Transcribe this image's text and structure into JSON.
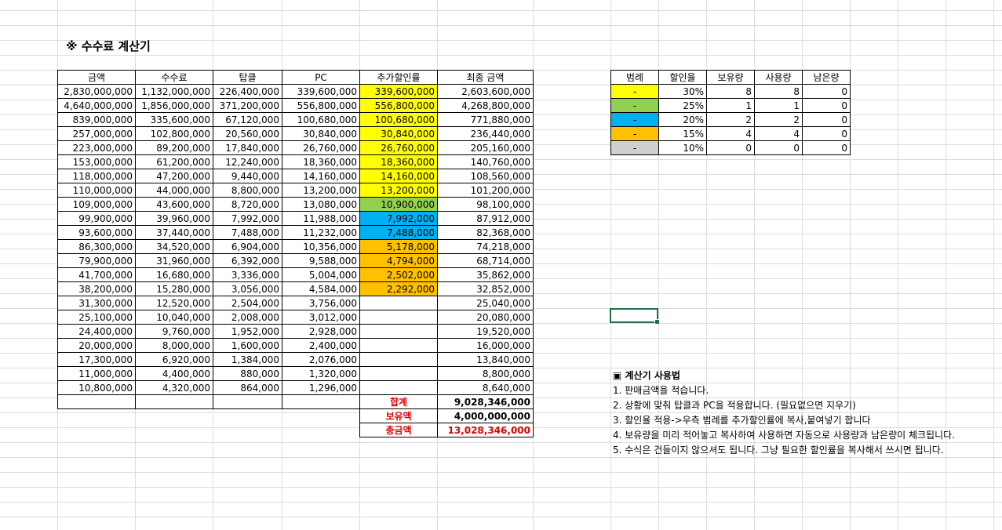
{
  "title": "※ 수수료 계산기",
  "main_table": {
    "headers": [
      "금액",
      "수수료",
      "탑클",
      "PC",
      "추가할인률",
      "최종 금액"
    ],
    "rows": [
      [
        "2,830,000,000",
        "1,132,000,000",
        "226,400,000",
        "339,600,000",
        "339,600,000",
        "2,603,600,000"
      ],
      [
        "4,640,000,000",
        "1,856,000,000",
        "371,200,000",
        "556,800,000",
        "556,800,000",
        "4,268,800,000"
      ],
      [
        "839,000,000",
        "335,600,000",
        "67,120,000",
        "100,680,000",
        "100,680,000",
        "771,880,000"
      ],
      [
        "257,000,000",
        "102,800,000",
        "20,560,000",
        "30,840,000",
        "30,840,000",
        "236,440,000"
      ],
      [
        "223,000,000",
        "89,200,000",
        "17,840,000",
        "26,760,000",
        "26,760,000",
        "205,160,000"
      ],
      [
        "153,000,000",
        "61,200,000",
        "12,240,000",
        "18,360,000",
        "18,360,000",
        "140,760,000"
      ],
      [
        "118,000,000",
        "47,200,000",
        "9,440,000",
        "14,160,000",
        "14,160,000",
        "108,560,000"
      ],
      [
        "110,000,000",
        "44,000,000",
        "8,800,000",
        "13,200,000",
        "13,200,000",
        "101,200,000"
      ],
      [
        "109,000,000",
        "43,600,000",
        "8,720,000",
        "13,080,000",
        "10,900,000",
        "98,100,000"
      ],
      [
        "99,900,000",
        "39,960,000",
        "7,992,000",
        "11,988,000",
        "7,992,000",
        "87,912,000"
      ],
      [
        "93,600,000",
        "37,440,000",
        "7,488,000",
        "11,232,000",
        "7,488,000",
        "82,368,000"
      ],
      [
        "86,300,000",
        "34,520,000",
        "6,904,000",
        "10,356,000",
        "5,178,000",
        "74,218,000"
      ],
      [
        "79,900,000",
        "31,960,000",
        "6,392,000",
        "9,588,000",
        "4,794,000",
        "68,714,000"
      ],
      [
        "41,700,000",
        "16,680,000",
        "3,336,000",
        "5,004,000",
        "2,502,000",
        "35,862,000"
      ],
      [
        "38,200,000",
        "15,280,000",
        "3,056,000",
        "4,584,000",
        "2,292,000",
        "32,852,000"
      ],
      [
        "31,300,000",
        "12,520,000",
        "2,504,000",
        "3,756,000",
        "",
        "25,040,000"
      ],
      [
        "25,100,000",
        "10,040,000",
        "2,008,000",
        "3,012,000",
        "",
        "20,080,000"
      ],
      [
        "24,400,000",
        "9,760,000",
        "1,952,000",
        "2,928,000",
        "",
        "19,520,000"
      ],
      [
        "20,000,000",
        "8,000,000",
        "1,600,000",
        "2,400,000",
        "",
        "16,000,000"
      ],
      [
        "17,300,000",
        "6,920,000",
        "1,384,000",
        "2,076,000",
        "",
        "13,840,000"
      ],
      [
        "11,000,000",
        "4,400,000",
        "880,000",
        "1,320,000",
        "",
        "8,800,000"
      ],
      [
        "10,800,000",
        "4,320,000",
        "864,000",
        "1,296,000",
        "",
        "8,640,000"
      ]
    ],
    "discount_colors": [
      "#ffff00",
      "#ffff00",
      "#ffff00",
      "#ffff00",
      "#ffff00",
      "#ffff00",
      "#ffff00",
      "#ffff00",
      "#92d050",
      "#00b0f0",
      "#00b0f0",
      "#ffc000",
      "#ffc000",
      "#ffc000",
      "#ffc000",
      "",
      "",
      "",
      "",
      "",
      "",
      ""
    ],
    "summary": [
      {
        "label": "합계",
        "value": "9,028,346,000"
      },
      {
        "label": "보유액",
        "value": "4,000,000,000"
      },
      {
        "label": "총금액",
        "value": "13,028,346,000"
      }
    ]
  },
  "legend_table": {
    "headers": [
      "범례",
      "할인율",
      "보유량",
      "사용량",
      "남은량"
    ],
    "rows": [
      {
        "swatch": "-",
        "color": "#ffff00",
        "rate": "30%",
        "own": "8",
        "used": "8",
        "left": "0"
      },
      {
        "swatch": "-",
        "color": "#92d050",
        "rate": "25%",
        "own": "1",
        "used": "1",
        "left": "0"
      },
      {
        "swatch": "-",
        "color": "#00b0f0",
        "rate": "20%",
        "own": "2",
        "used": "2",
        "left": "0"
      },
      {
        "swatch": "-",
        "color": "#ffc000",
        "rate": "15%",
        "own": "4",
        "used": "4",
        "left": "0"
      },
      {
        "swatch": "-",
        "color": "#d0cece",
        "rate": "10%",
        "own": "0",
        "used": "0",
        "left": "0"
      }
    ]
  },
  "help": {
    "title": "▣ 계산기 사용법",
    "lines": [
      "1. 판매금액을 적습니다.",
      "2. 상황에 맞춰 탑클과 PC을 적용합니다. (필요없으면 지우기)",
      "3. 할인율 적용->우측 범례를 추가할인률에 복사,붙여넣기 합니다",
      "4. 보유량을 미리 적어놓고 복사하여 사용하면 자동으로 사용량과 남은량이 체크됩니다.",
      "5. 수식은 건들이지 않으셔도 됩니다. 그냥 필요한 할인률을 복사해서 쓰시면 됩니다."
    ]
  }
}
